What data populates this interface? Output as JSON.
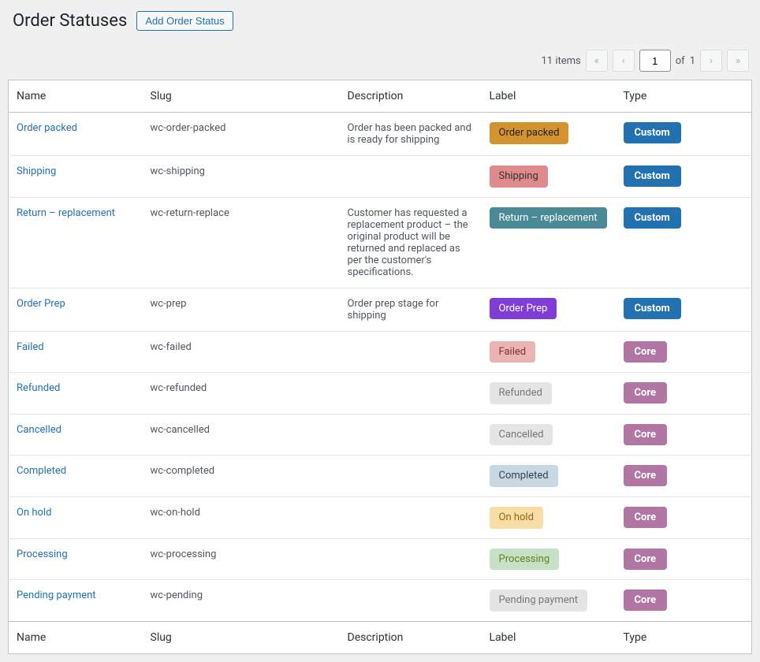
{
  "header": {
    "title": "Order Statuses",
    "add_button": "Add Order Status"
  },
  "pagination": {
    "items_label": "11 items",
    "current_page": "1",
    "total_pages": "1",
    "of_label": "of"
  },
  "columns": {
    "name": "Name",
    "slug": "Slug",
    "description": "Description",
    "label": "Label",
    "type": "Type"
  },
  "type_labels": {
    "custom": "Custom",
    "core": "Core"
  },
  "rows": [
    {
      "name": "Order packed",
      "slug": "wc-order-packed",
      "description": "Order has been packed and is ready for shipping",
      "label": "Order packed",
      "label_bg": "#d39430",
      "label_fg": "#222222",
      "type": "custom"
    },
    {
      "name": "Shipping",
      "slug": "wc-shipping",
      "description": "",
      "label": "Shipping",
      "label_bg": "#e08b8b",
      "label_fg": "#333333",
      "type": "custom"
    },
    {
      "name": "Return – replacement",
      "slug": "wc-return-replace",
      "description": "Customer has requested a replacement product – the original product will be returned and replaced as per the customer's specifications.",
      "label": "Return – replacement",
      "label_bg": "#4a8996",
      "label_fg": "#ffffff",
      "type": "custom"
    },
    {
      "name": "Order Prep",
      "slug": "wc-prep",
      "description": "Order prep stage for shipping",
      "label": "Order Prep",
      "label_bg": "#7f3dd6",
      "label_fg": "#ffffff",
      "type": "custom"
    },
    {
      "name": "Failed",
      "slug": "wc-failed",
      "description": "",
      "label": "Failed",
      "label_bg": "#ecb3b3",
      "label_fg": "#7a3434",
      "type": "core"
    },
    {
      "name": "Refunded",
      "slug": "wc-refunded",
      "description": "",
      "label": "Refunded",
      "label_bg": "#e5e5e5",
      "label_fg": "#777777",
      "type": "core"
    },
    {
      "name": "Cancelled",
      "slug": "wc-cancelled",
      "description": "",
      "label": "Cancelled",
      "label_bg": "#e5e5e5",
      "label_fg": "#777777",
      "type": "core"
    },
    {
      "name": "Completed",
      "slug": "wc-completed",
      "description": "",
      "label": "Completed",
      "label_bg": "#c8d7e1",
      "label_fg": "#2e4453",
      "type": "core"
    },
    {
      "name": "On hold",
      "slug": "wc-on-hold",
      "description": "",
      "label": "On hold",
      "label_bg": "#f8dda7",
      "label_fg": "#94660c",
      "type": "core"
    },
    {
      "name": "Processing",
      "slug": "wc-processing",
      "description": "",
      "label": "Processing",
      "label_bg": "#c6e1c6",
      "label_fg": "#5b841b",
      "type": "core"
    },
    {
      "name": "Pending payment",
      "slug": "wc-pending",
      "description": "",
      "label": "Pending payment",
      "label_bg": "#e5e5e5",
      "label_fg": "#777777",
      "type": "core"
    }
  ]
}
